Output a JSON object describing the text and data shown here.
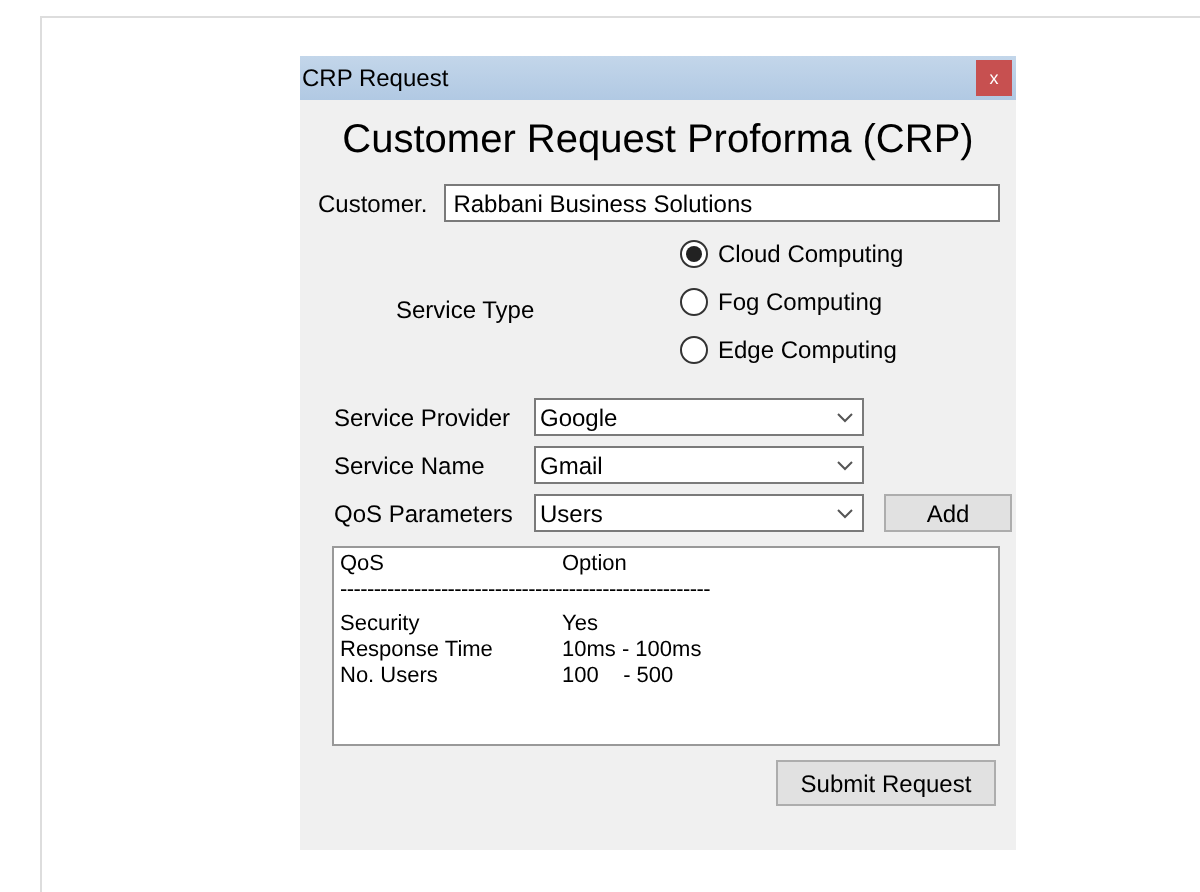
{
  "window": {
    "title": "CRP Request",
    "close": "x"
  },
  "heading": "Customer Request Proforma (CRP)",
  "customer": {
    "label": "Customer.",
    "value": "Rabbani Business Solutions"
  },
  "service_type": {
    "label": "Service Type",
    "options": [
      {
        "label": "Cloud Computing",
        "selected": true
      },
      {
        "label": "Fog Computing",
        "selected": false
      },
      {
        "label": "Edge Computing",
        "selected": false
      }
    ]
  },
  "dropdowns": [
    {
      "label": "Service Provider",
      "value": "Google"
    },
    {
      "label": "Service Name",
      "value": "Gmail"
    },
    {
      "label": "QoS Parameters",
      "value": "Users"
    }
  ],
  "add_button": "Add",
  "listbox": {
    "header": [
      "QoS",
      "Option"
    ],
    "separator": "-------------------------------------------------------",
    "rows": [
      [
        "Security",
        "Yes"
      ],
      [
        "Response Time",
        "10ms - 100ms"
      ],
      [
        "No. Users",
        "100    - 500"
      ]
    ]
  },
  "submit_button": "Submit Request"
}
